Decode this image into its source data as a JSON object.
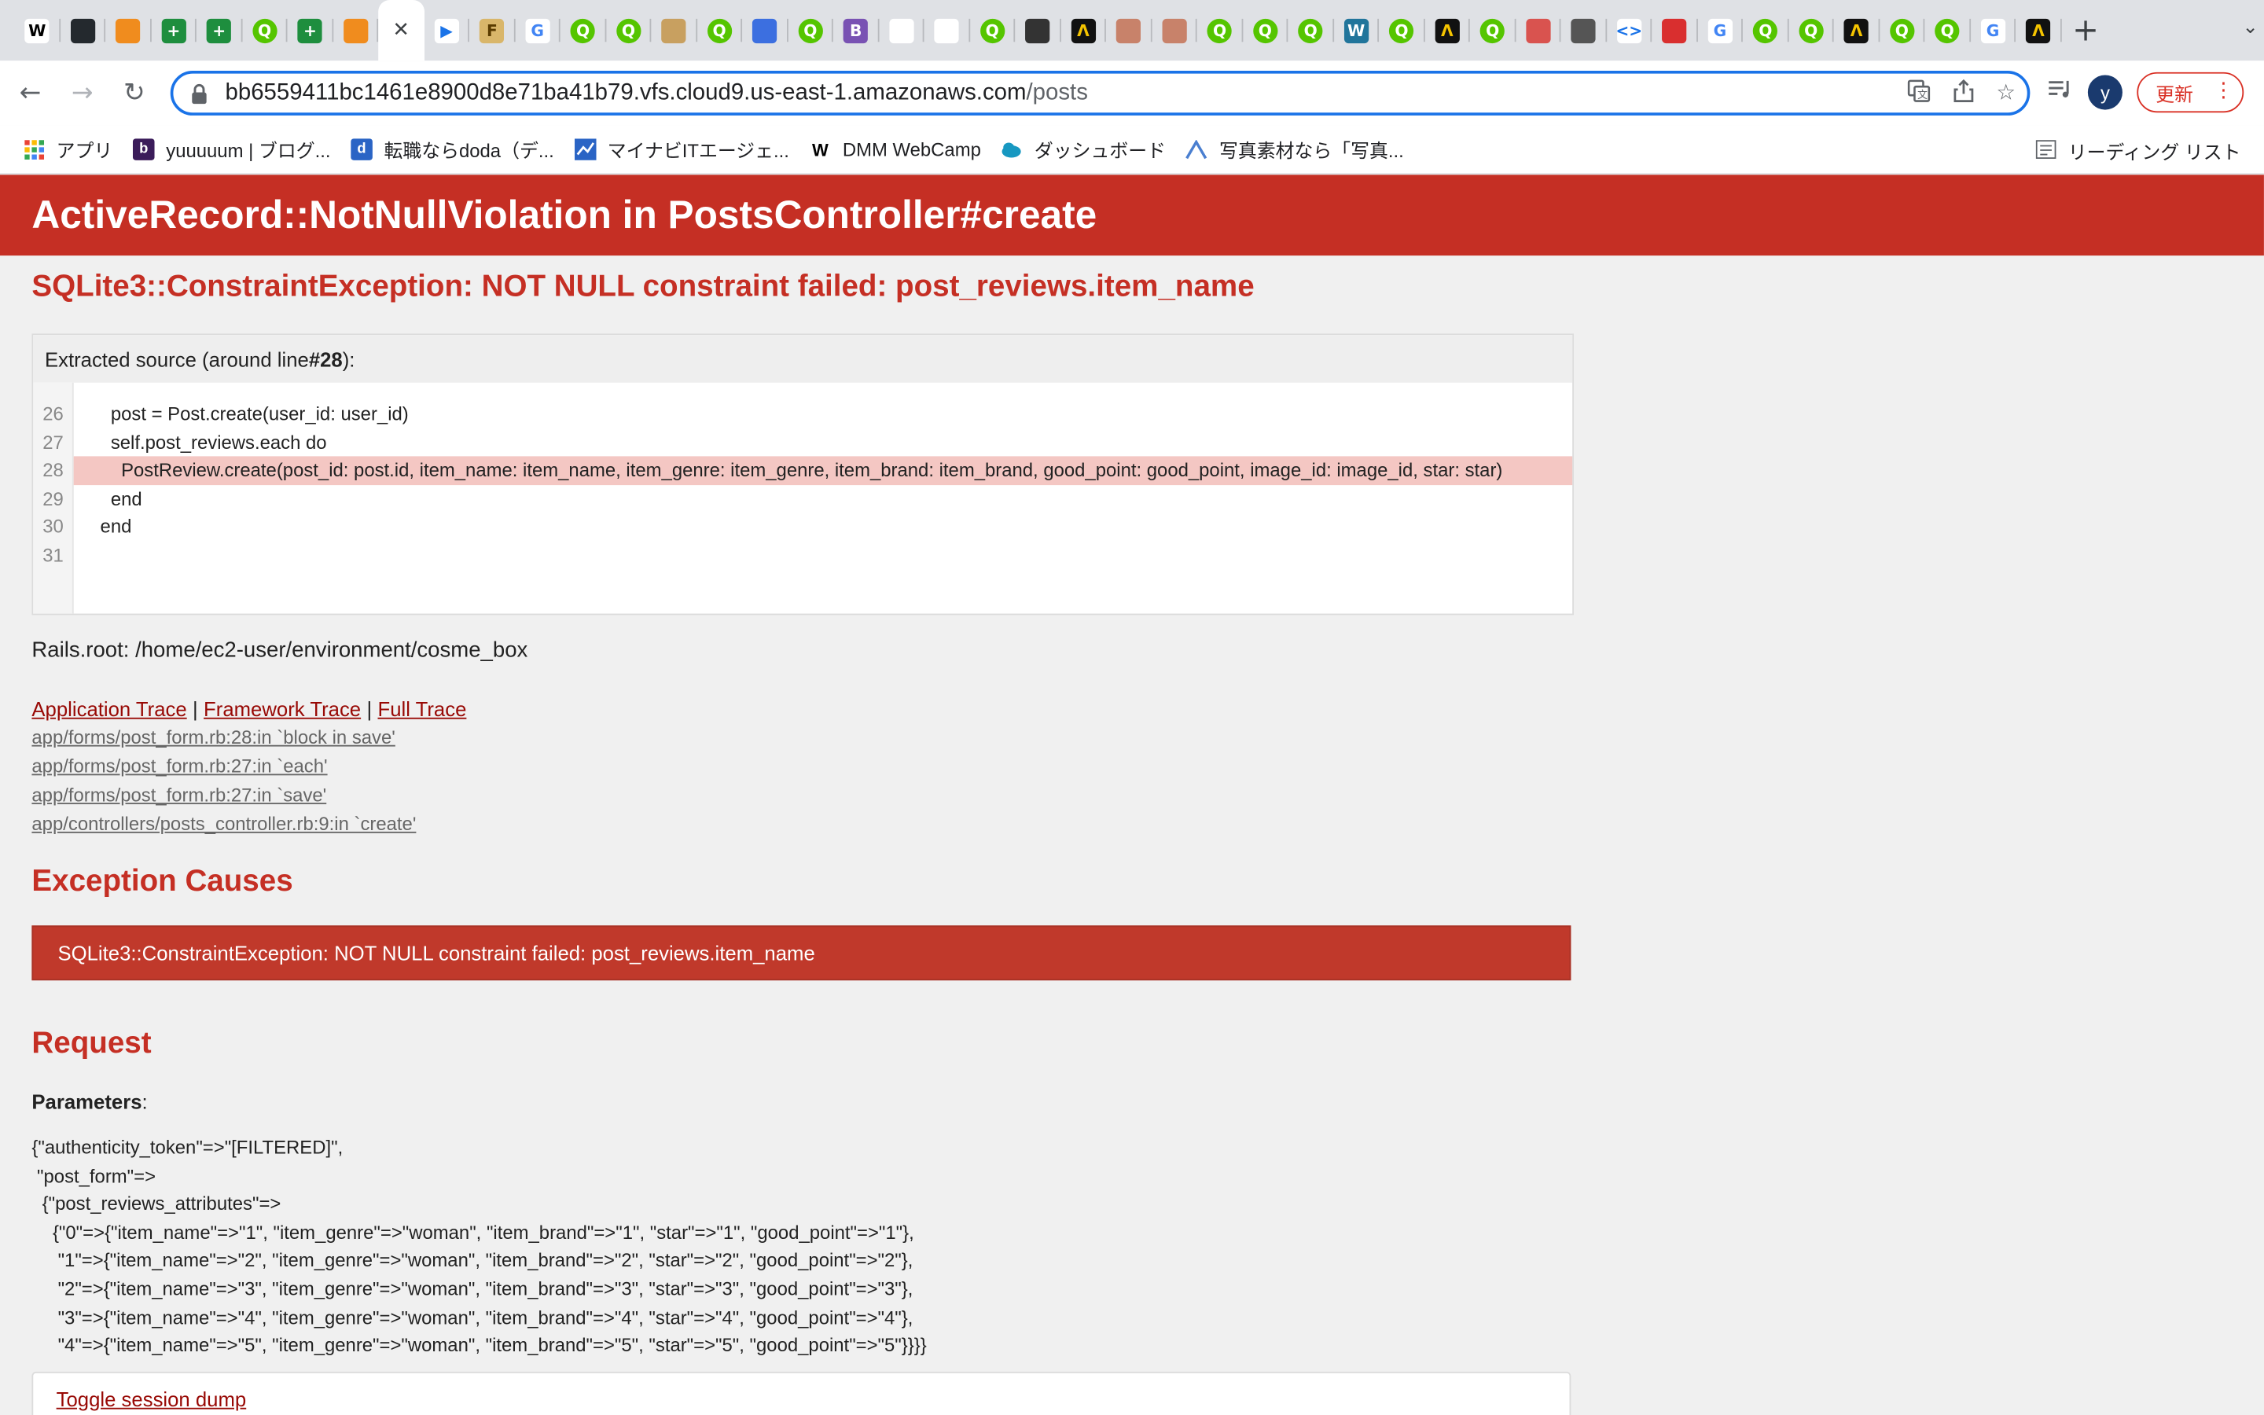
{
  "browser": {
    "tabs": [
      {
        "icon": "wikipedia-icon",
        "glyph": "W",
        "color": "#ffffff",
        "fg": "#000000"
      },
      {
        "icon": "github-icon",
        "glyph": "",
        "color": "#24292e",
        "fg": "#ffffff"
      },
      {
        "icon": "app-icon",
        "glyph": "",
        "color": "#f08c1e",
        "fg": "#ffffff"
      },
      {
        "icon": "sheets-icon",
        "glyph": "+",
        "color": "#1e8e3e",
        "fg": "#ffffff"
      },
      {
        "icon": "sheets-icon",
        "glyph": "+",
        "color": "#1e8e3e",
        "fg": "#ffffff"
      },
      {
        "icon": "qiita-icon",
        "glyph": "Q",
        "color": "#55c500",
        "fg": "#ffffff"
      },
      {
        "icon": "sheets-icon",
        "glyph": "+",
        "color": "#1e8e3e",
        "fg": "#ffffff"
      },
      {
        "icon": "cube-icon",
        "glyph": "",
        "color": "#f08c1e",
        "fg": "#ffffff"
      },
      {
        "icon": "close-icon",
        "glyph": "✕",
        "color": "transparent",
        "fg": "#3c4043",
        "active": true
      },
      {
        "icon": "play-icon",
        "glyph": "▶",
        "color": "#ffffff",
        "fg": "#1a73e8"
      },
      {
        "icon": "f-icon",
        "glyph": "F",
        "color": "#d9b66a",
        "fg": "#5a3b00"
      },
      {
        "icon": "google-icon",
        "glyph": "G",
        "color": "#ffffff",
        "fg": "#4285f4"
      },
      {
        "icon": "qiita-icon",
        "glyph": "Q",
        "color": "#55c500",
        "fg": "#ffffff"
      },
      {
        "icon": "qiita-icon",
        "glyph": "Q",
        "color": "#55c500",
        "fg": "#ffffff"
      },
      {
        "icon": "checker-icon",
        "glyph": "",
        "color": "#c8a060",
        "fg": "#ffffff"
      },
      {
        "icon": "qiita-icon",
        "glyph": "Q",
        "color": "#55c500",
        "fg": "#ffffff"
      },
      {
        "icon": "loop-icon",
        "glyph": "",
        "color": "#3c6fe0",
        "fg": "#ffffff"
      },
      {
        "icon": "qiita-icon",
        "glyph": "Q",
        "color": "#55c500",
        "fg": "#ffffff"
      },
      {
        "icon": "bootstrap-icon",
        "glyph": "B",
        "color": "#7952b3",
        "fg": "#ffffff"
      },
      {
        "icon": "figma-icon",
        "glyph": "",
        "color": "#ffffff",
        "fg": "#3b5bdb"
      },
      {
        "icon": "stripe-icon",
        "glyph": "",
        "color": "#ffffff",
        "fg": "#4a90d9"
      },
      {
        "icon": "qiita-icon",
        "glyph": "Q",
        "color": "#55c500",
        "fg": "#ffffff"
      },
      {
        "icon": "cat-icon",
        "glyph": "",
        "color": "#333333",
        "fg": "#ffffff"
      },
      {
        "icon": "atcoder-icon",
        "glyph": "Λ",
        "color": "#111111",
        "fg": "#f5c400"
      },
      {
        "icon": "frame-icon",
        "glyph": "",
        "color": "#c8826a",
        "fg": "#ffffff"
      },
      {
        "icon": "frame-icon",
        "glyph": "",
        "color": "#c8826a",
        "fg": "#ffffff"
      },
      {
        "icon": "qiita-icon",
        "glyph": "Q",
        "color": "#55c500",
        "fg": "#ffffff"
      },
      {
        "icon": "qiita-icon",
        "glyph": "Q",
        "color": "#55c500",
        "fg": "#ffffff"
      },
      {
        "icon": "qiita-icon",
        "glyph": "Q",
        "color": "#55c500",
        "fg": "#ffffff"
      },
      {
        "icon": "wordpress-icon",
        "glyph": "W",
        "color": "#21759b",
        "fg": "#ffffff"
      },
      {
        "icon": "qiita-icon",
        "glyph": "Q",
        "color": "#55c500",
        "fg": "#ffffff"
      },
      {
        "icon": "atcoder-icon",
        "glyph": "Λ",
        "color": "#111111",
        "fg": "#f5c400"
      },
      {
        "icon": "qiita-icon",
        "glyph": "Q",
        "color": "#55c500",
        "fg": "#ffffff"
      },
      {
        "icon": "food-icon",
        "glyph": "",
        "color": "#d9534f",
        "fg": "#ffffff"
      },
      {
        "icon": "globe-icon",
        "glyph": "",
        "color": "#555555",
        "fg": "#ffffff"
      },
      {
        "icon": "code-icon",
        "glyph": "<>",
        "color": "#ffffff",
        "fg": "#1a73e8"
      },
      {
        "icon": "red-app-icon",
        "glyph": "",
        "color": "#d92f2f",
        "fg": "#ffffff"
      },
      {
        "icon": "google-icon",
        "glyph": "G",
        "color": "#ffffff",
        "fg": "#4285f4"
      },
      {
        "icon": "qiita-icon",
        "glyph": "Q",
        "color": "#55c500",
        "fg": "#ffffff"
      },
      {
        "icon": "qiita-icon",
        "glyph": "Q",
        "color": "#55c500",
        "fg": "#ffffff"
      },
      {
        "icon": "atcoder-icon",
        "glyph": "Λ",
        "color": "#111111",
        "fg": "#f5c400"
      },
      {
        "icon": "qiita-icon",
        "glyph": "Q",
        "color": "#55c500",
        "fg": "#ffffff"
      },
      {
        "icon": "qiita-icon",
        "glyph": "Q",
        "color": "#55c500",
        "fg": "#ffffff"
      },
      {
        "icon": "google-icon",
        "glyph": "G",
        "color": "#ffffff",
        "fg": "#4285f4"
      },
      {
        "icon": "atcoder-icon",
        "glyph": "Λ",
        "color": "#111111",
        "fg": "#f5c400"
      }
    ],
    "url_host": "bb6559411bc1461e8900d8e71ba41b79.vfs.cloud9.us-east-1.amazonaws.com",
    "url_path": "/posts",
    "avatar_letter": "y",
    "update_label": "更新"
  },
  "bookmarks": [
    {
      "label": "アプリ",
      "icon": "apps-grid-icon",
      "color": "transparent"
    },
    {
      "label": "yuuuuum | ブログ...",
      "icon": "blog-icon",
      "color": "#3b1c5a"
    },
    {
      "label": "転職ならdoda（デ...",
      "icon": "doda-icon",
      "color": "#2a64c5"
    },
    {
      "label": "マイナビITエージェ...",
      "icon": "chart-icon",
      "color": "#2a64c5"
    },
    {
      "label": "DMM WebCamp",
      "icon": "dmm-icon",
      "color": "transparent"
    },
    {
      "label": "ダッシュボード",
      "icon": "cloud-icon",
      "color": "transparent"
    },
    {
      "label": "写真素材なら「写真...",
      "icon": "mountain-icon",
      "color": "transparent"
    }
  ],
  "reading_list": "リーディング リスト",
  "error": {
    "title": "ActiveRecord::NotNullViolation in PostsController#create",
    "message": "SQLite3::ConstraintException: NOT NULL constraint failed: post_reviews.item_name",
    "source_header_pre": "Extracted source (around line ",
    "source_header_line": "#28",
    "source_header_post": "):",
    "source_lines": [
      {
        "num": "26",
        "code": "      post = Post.create(user_id: user_id)",
        "highlight": false
      },
      {
        "num": "27",
        "code": "      self.post_reviews.each do",
        "highlight": false
      },
      {
        "num": "28",
        "code": "        PostReview.create(post_id: post.id, item_name: item_name, item_genre: item_genre, item_brand: item_brand, good_point: good_point, image_id: image_id, star: star)",
        "highlight": true
      },
      {
        "num": "29",
        "code": "      end",
        "highlight": false
      },
      {
        "num": "30",
        "code": "    end",
        "highlight": false
      },
      {
        "num": "31",
        "code": "",
        "highlight": false
      }
    ],
    "rails_root": "Rails.root: /home/ec2-user/environment/cosme_box",
    "trace_links": [
      "Application Trace",
      "Framework Trace",
      "Full Trace"
    ],
    "trace_separator": "|",
    "trace_lines": [
      "app/forms/post_form.rb:28:in `block in save'",
      "app/forms/post_form.rb:27:in `each'",
      "app/forms/post_form.rb:27:in `save'",
      "app/controllers/posts_controller.rb:9:in `create'"
    ],
    "exception_causes_title": "Exception Causes",
    "cause": "SQLite3::ConstraintException: NOT NULL constraint failed: post_reviews.item_name",
    "request_title": "Request",
    "parameters_label": "Parameters",
    "parameters_colon": ":",
    "params_lines": [
      "{\"authenticity_token\"=>\"[FILTERED]\",",
      " \"post_form\"=>",
      "  {\"post_reviews_attributes\"=>",
      "    {\"0\"=>{\"item_name\"=>\"1\", \"item_genre\"=>\"woman\", \"item_brand\"=>\"1\", \"star\"=>\"1\", \"good_point\"=>\"1\"},",
      "     \"1\"=>{\"item_name\"=>\"2\", \"item_genre\"=>\"woman\", \"item_brand\"=>\"2\", \"star\"=>\"2\", \"good_point\"=>\"2\"},",
      "     \"2\"=>{\"item_name\"=>\"3\", \"item_genre\"=>\"woman\", \"item_brand\"=>\"3\", \"star\"=>\"3\", \"good_point\"=>\"3\"},",
      "     \"3\"=>{\"item_name\"=>\"4\", \"item_genre\"=>\"woman\", \"item_brand\"=>\"4\", \"star\"=>\"4\", \"good_point\"=>\"4\"},",
      "     \"4\"=>{\"item_name\"=>\"5\", \"item_genre\"=>\"woman\", \"item_brand\"=>\"5\", \"star\"=>\"5\", \"good_point\"=>\"5\"}}}}"
    ],
    "toggle_session": "Toggle session dump"
  },
  "colors": {
    "header_red": "#c52f24",
    "link_red": "#980905",
    "cause_red": "#c0392b",
    "highlight": "#f4c7c3"
  }
}
